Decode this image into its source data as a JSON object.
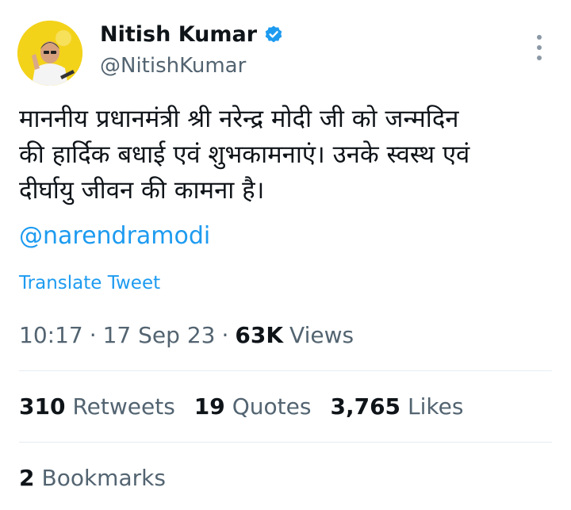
{
  "author": {
    "name": "Nitish Kumar",
    "handle": "@NitishKumar",
    "verified_icon": "verified-badge-icon",
    "accent_color": "#1d9bf0"
  },
  "tweet": {
    "text": "माननीय प्रधानमंत्री श्री नरेन्द्र मोदी जी को जन्मदिन\nकी हार्दिक बधाई एवं शुभकामनाएं। उनके स्वस्थ एवं\nदीर्घायु जीवन की कामना है।",
    "mention": "@narendramodi",
    "translate_label": "Translate Tweet"
  },
  "meta": {
    "time": "10:17",
    "separator": "·",
    "date": "17 Sep 23",
    "views_count": "63K",
    "views_label": "Views"
  },
  "stats": {
    "retweets_count": "310",
    "retweets_label": "Retweets",
    "quotes_count": "19",
    "quotes_label": "Quotes",
    "likes_count": "3,765",
    "likes_label": "Likes",
    "bookmarks_count": "2",
    "bookmarks_label": "Bookmarks"
  }
}
